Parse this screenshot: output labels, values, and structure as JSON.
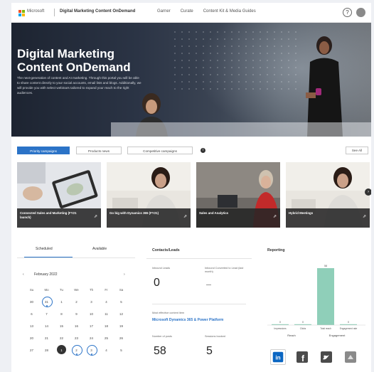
{
  "topbar": {
    "brand": "Microsoft",
    "app_title": "Digital Marketing Content OnDemand",
    "nav": [
      "Garner",
      "Curate",
      "Content Kit & Media Guides"
    ],
    "help_icon": "help-icon",
    "avatar_icon": "user-avatar-icon"
  },
  "hero": {
    "title": "Digital Marketing Content OnDemand",
    "description": "The next-generation of content and AI marketing. Through this portal you will be able to share content directly to your social accounts, email lists and blogs. Additionally, we will provide you with select webinars tailored to expand your reach to the right audiences."
  },
  "tabs": {
    "items": [
      "Priority campaigns",
      "Products news",
      "Competitive campaigns"
    ],
    "active_index": 0,
    "see_all": "See All"
  },
  "cards": [
    {
      "title": "Connected Sales and Marketing (FY21 launch)"
    },
    {
      "title": "Go big with Dynamics 365 (FY21)"
    },
    {
      "title": "Sales and Analytics"
    },
    {
      "title": "Hybrid Meetings"
    }
  ],
  "schedule": {
    "tabs": [
      "Scheduled",
      "Available"
    ],
    "active_tab": 0,
    "month": "February 2022",
    "weekdays": [
      "Su",
      "Mo",
      "Tu",
      "We",
      "Th",
      "Fr",
      "Sa"
    ],
    "weeks": [
      [
        "30",
        "31",
        "1",
        "2",
        "3",
        "4",
        "5"
      ],
      [
        "6",
        "7",
        "8",
        "9",
        "10",
        "11",
        "12"
      ],
      [
        "13",
        "14",
        "15",
        "16",
        "17",
        "18",
        "19"
      ],
      [
        "20",
        "21",
        "22",
        "23",
        "24",
        "25",
        "26"
      ],
      [
        "27",
        "28",
        "1",
        "2",
        "3",
        "4",
        "5"
      ]
    ]
  },
  "contacts": {
    "title": "Contacts/Leads",
    "leads_label": "Inbound Leads",
    "leads_value": "0",
    "lead_conv_label": "Inbound Converted to Lead (last month)",
    "lead_conv_value": "—",
    "link_label": "Most effective content item",
    "link_text": "Microsoft Dynamics 365 & Power Platform",
    "posts_label": "Number of posts",
    "posts_value": "58",
    "sessions_label": "Sessions booked",
    "sessions_value": "5"
  },
  "reporting": {
    "title": "Reporting",
    "group_labels": [
      "Reach",
      "Engagement"
    ],
    "social_icons": [
      "linkedin-icon",
      "facebook-icon",
      "twitter-icon",
      "other-social-icon"
    ]
  },
  "chart_data": {
    "type": "bar",
    "categories": [
      "Impressions",
      "Clicks",
      "Total reach",
      "Engagement rate"
    ],
    "values": [
      0,
      0,
      58,
      0
    ],
    "group_labels": [
      "Reach",
      "Engagement"
    ],
    "title": "",
    "xlabel": "",
    "ylabel": "",
    "bar_color": "#8fcfb9"
  },
  "colors": {
    "accent": "#2b73c7",
    "dark": "#333333"
  }
}
